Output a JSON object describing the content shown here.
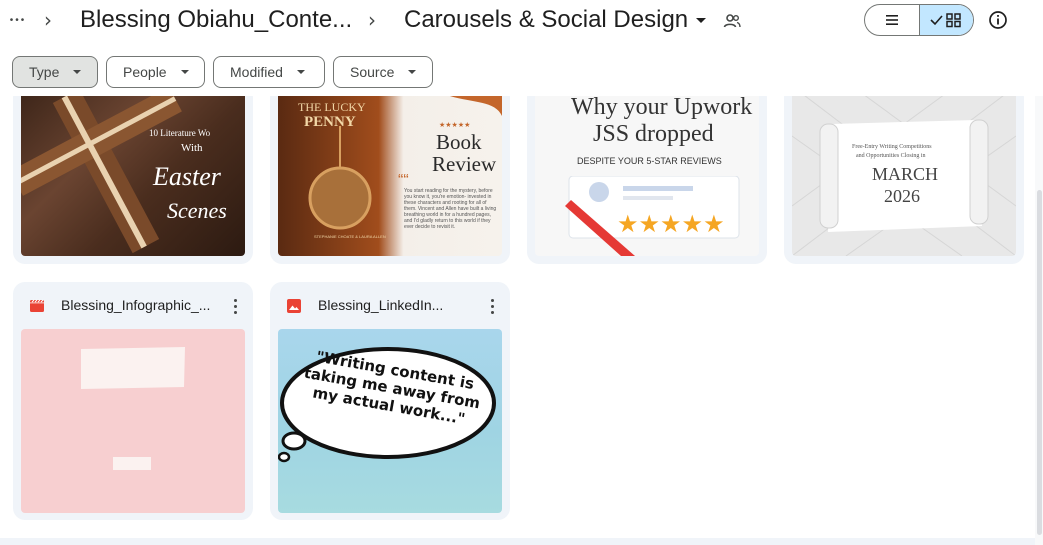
{
  "breadcrumb": {
    "more": "•••",
    "parent": "Blessing Obiahu_Conte...",
    "current": "Carousels & Social Design"
  },
  "filters": [
    {
      "label": "Type"
    },
    {
      "label": "People"
    },
    {
      "label": "Modified"
    },
    {
      "label": "Source"
    }
  ],
  "cards": [
    {
      "thumb_text": {
        "line1": "10 Literature Wo",
        "line2": "With",
        "line3": "Easter",
        "line4": "Scenes"
      }
    },
    {
      "thumb_text": {
        "title1": "THE LUCKY",
        "title2": "PENNY",
        "stars": "★★★★★",
        "review1": "Book",
        "review2": "Review",
        "quote": "““",
        "author": "STEPHANIE CHOATE & LAURA ALLEN",
        "body": "You start reading for the mystery, before you know it, you're emotion- invested in these characters and rooting for all of them. Vincent and Allen have built a living breathing world in for a hundred pages, and I'd gladly return to this world if they ever decide to revisit it."
      }
    },
    {
      "thumb_text": {
        "line1": "Why your Upwork",
        "line2": "JSS dropped",
        "line3": "DESPITE YOUR 5-STAR REVIEWS",
        "stars": "★★★★★"
      }
    },
    {
      "thumb_text": {
        "line1": "Free-Entry Writing Competitions",
        "line2": "and Opportunities Closing in",
        "month": "MARCH",
        "year": "2026"
      }
    },
    {
      "name": "Blessing_Infographic_...",
      "icon": "video-file-icon"
    },
    {
      "name": "Blessing_LinkedIn...",
      "icon": "image-file-icon",
      "thumb_text": {
        "bubble1": "\"Writing content is",
        "bubble2": "taking me away from",
        "bubble3": "my actual work...\""
      }
    }
  ],
  "colors": {
    "card_bg": "#f0f4f9",
    "selected_toggle": "#c2e7ff",
    "video_icon": "#ea4335",
    "image_icon": "#ea4335"
  }
}
